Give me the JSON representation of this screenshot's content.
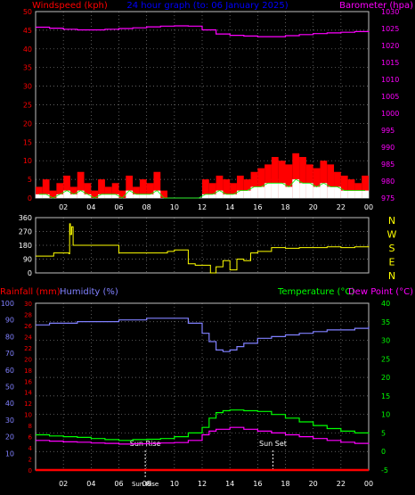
{
  "title": "24 hour graph (to: 06 January 2025)",
  "colors": {
    "background": "#000000",
    "grid": "#808080",
    "axis": "#c0c0c0",
    "windspeed": "#ff0000",
    "gust_fill": "#ff0000",
    "avg_wind": "#ffffff",
    "wind_line": "#00ff00",
    "barometer": "#ff00ff",
    "direction": "#ffff00",
    "rainfall": "#ff0000",
    "humidity": "#8080ff",
    "temperature": "#00ff00",
    "dewpoint": "#ff00ff",
    "title": "#0000ff",
    "text_white": "#ffffff"
  },
  "chart_data": [
    {
      "type": "area",
      "name": "wind-baro",
      "left_axis_label": "Windspeed (kph)",
      "right_axis_label": "Barometer (hpa)",
      "left_ticks": [
        "0",
        "5",
        "10",
        "15",
        "20",
        "25",
        "30",
        "35",
        "40",
        "45",
        "50"
      ],
      "left_range": [
        0,
        50
      ],
      "right_ticks": [
        "975",
        "980",
        "985",
        "990",
        "995",
        "1000",
        "1005",
        "1010",
        "1015",
        "1020",
        "1025",
        "1030"
      ],
      "right_range": [
        975,
        1030
      ],
      "x_ticks": [
        "02",
        "04",
        "06",
        "08",
        "10",
        "12",
        "14",
        "16",
        "18",
        "20",
        "22",
        "00"
      ],
      "x_range": [
        0,
        24
      ],
      "grid": true,
      "series": [
        {
          "name": "Barometer",
          "axis": "right",
          "x": [
            0,
            1,
            2,
            3,
            4,
            5,
            6,
            7,
            8,
            9,
            10,
            11,
            12,
            13,
            14,
            15,
            16,
            17,
            18,
            19,
            20,
            21,
            22,
            23,
            24
          ],
          "values": [
            1025.4,
            1025.1,
            1024.8,
            1024.6,
            1024.6,
            1024.8,
            1025.0,
            1025.2,
            1025.5,
            1025.7,
            1025.8,
            1025.7,
            1024.6,
            1023.4,
            1023.0,
            1022.8,
            1022.6,
            1022.6,
            1022.9,
            1023.2,
            1023.5,
            1023.7,
            1023.9,
            1024.1,
            1024.3
          ]
        },
        {
          "name": "Windspeed",
          "axis": "left",
          "x": [
            0,
            0.5,
            1,
            1.5,
            2,
            2.5,
            3,
            3.5,
            4,
            4.5,
            5,
            5.5,
            6,
            6.5,
            7,
            7.5,
            8,
            8.5,
            9,
            9.5,
            10,
            10.5,
            11,
            11.5,
            12,
            12.5,
            13,
            13.5,
            14,
            14.5,
            15,
            15.5,
            16,
            16.5,
            17,
            17.5,
            18,
            18.5,
            19,
            19.5,
            20,
            20.5,
            21,
            21.5,
            22,
            22.5,
            23,
            23.5
          ],
          "values": [
            3,
            5,
            2,
            4,
            6,
            3,
            7,
            4,
            2,
            5,
            3,
            4,
            2,
            6,
            3,
            5,
            4,
            7,
            2,
            0,
            0,
            0,
            0,
            0,
            5,
            4,
            6,
            5,
            4,
            6,
            5,
            7,
            8,
            9,
            11,
            10,
            9,
            12,
            11,
            9,
            8,
            10,
            9,
            7,
            6,
            5,
            4,
            6
          ]
        },
        {
          "name": "Average wind",
          "axis": "left",
          "x": [
            0,
            0.5,
            1,
            1.5,
            2,
            2.5,
            3,
            3.5,
            4,
            4.5,
            5,
            5.5,
            6,
            6.5,
            7,
            7.5,
            8,
            8.5,
            9,
            9.5,
            10,
            10.5,
            11,
            11.5,
            12,
            12.5,
            13,
            13.5,
            14,
            14.5,
            15,
            15.5,
            16,
            16.5,
            17,
            17.5,
            18,
            18.5,
            19,
            19.5,
            20,
            20.5,
            21,
            21.5,
            22,
            22.5,
            23,
            23.5
          ],
          "values": [
            1,
            1,
            0,
            1,
            2,
            1,
            2,
            1,
            0,
            1,
            1,
            1,
            0,
            2,
            1,
            1,
            1,
            2,
            0,
            0,
            0,
            0,
            0,
            0,
            1,
            1,
            2,
            1,
            1,
            2,
            2,
            3,
            3,
            4,
            4,
            4,
            3,
            5,
            4,
            4,
            3,
            4,
            3,
            3,
            2,
            2,
            2,
            2
          ]
        }
      ]
    },
    {
      "type": "line",
      "name": "wind-direction",
      "right_axis_label": "",
      "left_ticks": [
        "0",
        "90",
        "180",
        "270",
        "360"
      ],
      "left_range": [
        0,
        360
      ],
      "compass_labels": [
        "N",
        "W",
        "S",
        "E",
        "N"
      ],
      "x_range": [
        0,
        24
      ],
      "grid": true,
      "series": [
        {
          "name": "Wind direction",
          "x": [
            0,
            1.2,
            1.3,
            2.4,
            2.45,
            2.5,
            2.6,
            2.7,
            3.5,
            4.5,
            6.0,
            7.0,
            8.0,
            9.5,
            10.0,
            11.0,
            11.5,
            12.0,
            12.6,
            13.0,
            13.5,
            14.0,
            14.5,
            15.0,
            15.5,
            16.0,
            17.0,
            18.0,
            19.0,
            20.0,
            21.0,
            22.0,
            23.0,
            24.0
          ],
          "values": [
            110,
            110,
            130,
            125,
            320,
            250,
            300,
            180,
            180,
            180,
            130,
            130,
            130,
            140,
            150,
            60,
            50,
            50,
            0,
            40,
            80,
            20,
            90,
            80,
            130,
            140,
            165,
            160,
            165,
            165,
            170,
            165,
            170,
            175
          ]
        }
      ]
    },
    {
      "type": "line",
      "name": "rain-humidity-temp",
      "left_axis_label_1": "Rainfall (mm)",
      "left_axis_label_2": "Humidity (%)",
      "right_axis_label_1": "Temperature (°C)",
      "right_axis_label_2": "Dew Point (°C)",
      "rain_ticks": [
        "0",
        "2",
        "4",
        "6",
        "8",
        "10",
        "12",
        "14",
        "16",
        "18",
        "20",
        "22",
        "24",
        "26",
        "28",
        "30"
      ],
      "rain_range": [
        0,
        30
      ],
      "humidity_ticks": [
        "10",
        "20",
        "30",
        "40",
        "50",
        "60",
        "70",
        "80",
        "90",
        "100"
      ],
      "humidity_range": [
        0,
        100
      ],
      "temp_ticks": [
        "-5",
        "0",
        "5",
        "10",
        "15",
        "20",
        "25",
        "30",
        "35",
        "40"
      ],
      "temp_range": [
        -5,
        40
      ],
      "x_ticks": [
        "02",
        "04",
        "06",
        "08",
        "10",
        "12",
        "14",
        "16",
        "18",
        "20",
        "22",
        "00"
      ],
      "x_range": [
        0,
        24
      ],
      "annotations": [
        "Sun Rise",
        "Sun Rise",
        "Sun Set"
      ],
      "grid": true,
      "series": [
        {
          "name": "Humidity",
          "axis": "humidity",
          "x": [
            0,
            1,
            2,
            3,
            4,
            5,
            6,
            7,
            8,
            9,
            10,
            11,
            12,
            12.5,
            13,
            13.5,
            14,
            14.5,
            15,
            16,
            17,
            18,
            19,
            20,
            21,
            22,
            23,
            24
          ],
          "values": [
            87,
            88,
            88,
            89,
            89,
            89,
            90,
            90,
            91,
            91,
            91,
            88,
            82,
            77,
            72,
            71,
            72,
            74,
            76,
            79,
            80,
            81,
            82,
            83,
            84,
            84,
            85,
            86
          ]
        },
        {
          "name": "Temperature",
          "axis": "temp",
          "x": [
            0,
            1,
            2,
            3,
            4,
            5,
            6,
            7,
            8,
            9,
            10,
            11,
            12,
            12.5,
            13,
            13.5,
            14,
            15,
            16,
            17,
            18,
            19,
            20,
            21,
            22,
            23,
            24
          ],
          "values": [
            4.5,
            4.2,
            4.0,
            3.8,
            3.5,
            3.2,
            3.0,
            3.2,
            3.3,
            3.5,
            4.0,
            5.0,
            6.5,
            9.0,
            10.5,
            11.0,
            11.2,
            11.0,
            10.8,
            10.0,
            9.0,
            8.0,
            7.0,
            6.2,
            5.5,
            5.0,
            4.8
          ]
        },
        {
          "name": "Dew Point",
          "axis": "temp",
          "x": [
            0,
            1,
            2,
            3,
            4,
            5,
            6,
            7,
            8,
            9,
            10,
            11,
            12,
            12.5,
            13,
            13.5,
            14,
            15,
            16,
            17,
            18,
            19,
            20,
            21,
            22,
            23,
            24
          ],
          "values": [
            3.0,
            2.8,
            2.6,
            2.5,
            2.3,
            2.2,
            2.0,
            2.1,
            2.2,
            2.3,
            2.4,
            3.0,
            4.5,
            5.5,
            6.0,
            6.0,
            6.5,
            6.0,
            5.5,
            5.0,
            4.5,
            4.0,
            3.5,
            3.0,
            2.5,
            2.2,
            2.0
          ]
        },
        {
          "name": "Rainfall",
          "axis": "rain",
          "x": [
            0,
            24
          ],
          "values": [
            0,
            0
          ]
        }
      ]
    }
  ]
}
